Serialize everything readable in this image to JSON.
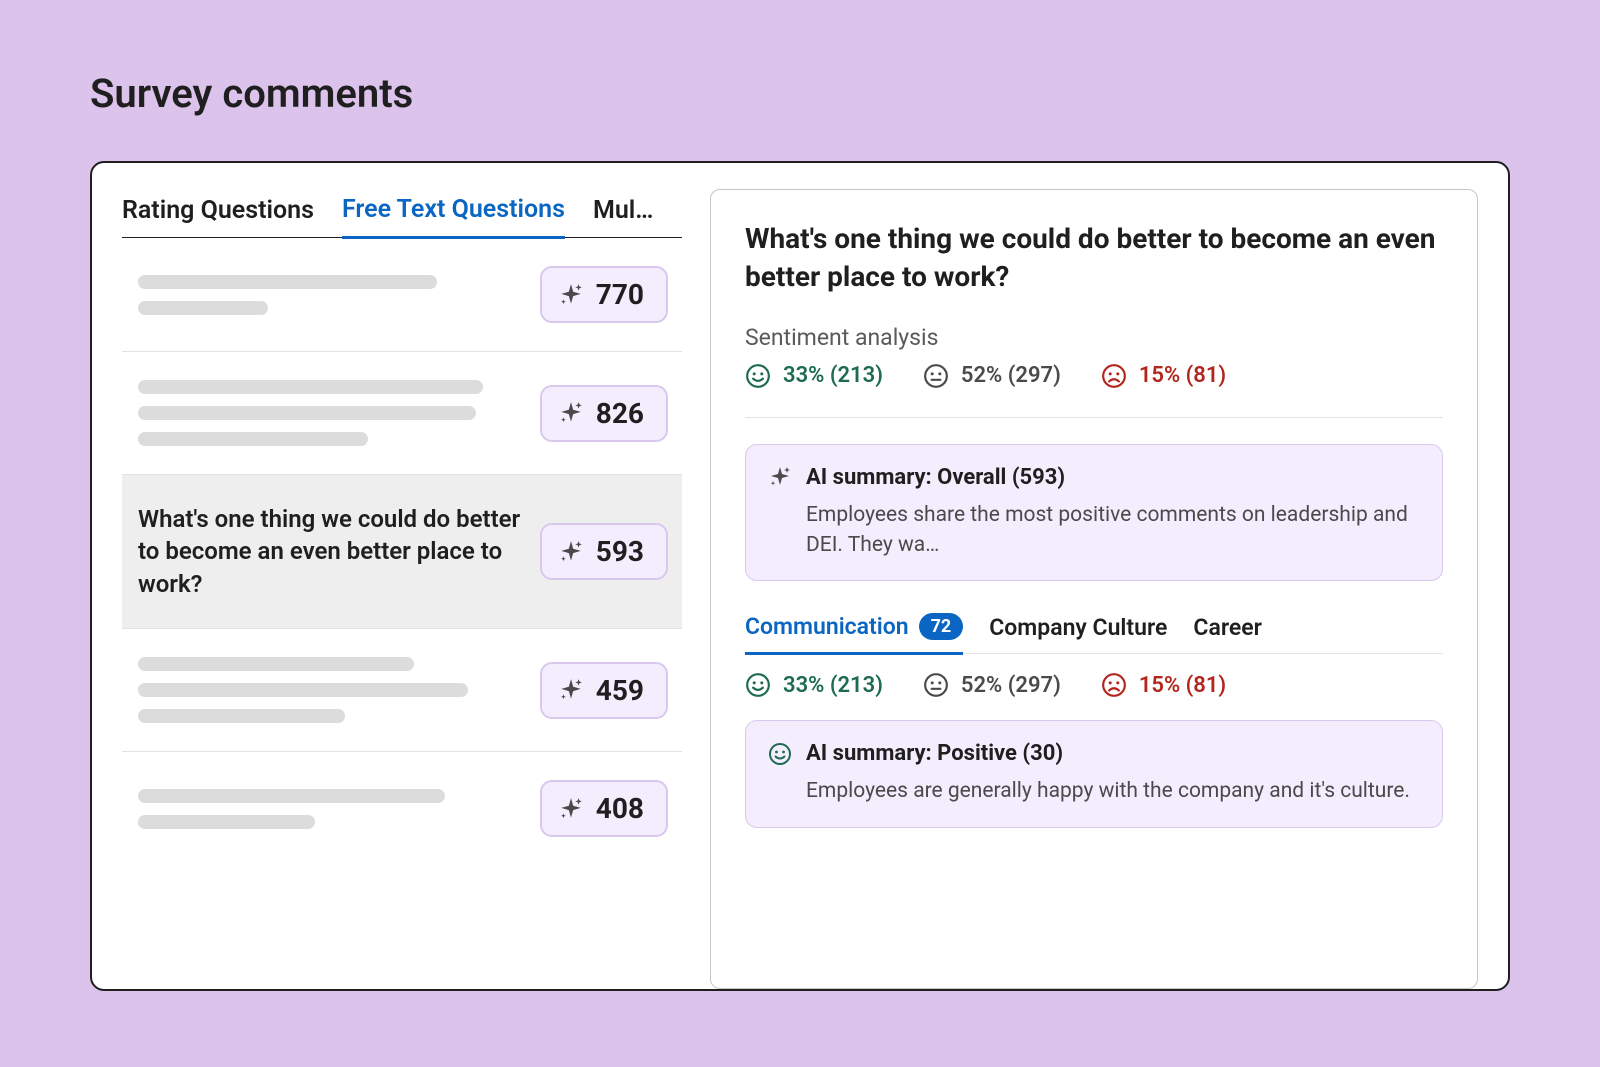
{
  "page": {
    "title": "Survey comments"
  },
  "tabs": {
    "rating": "Rating Questions",
    "freeText": "Free Text Questions",
    "multi": "Mult…"
  },
  "questions": [
    {
      "count": "770"
    },
    {
      "count": "826"
    },
    {
      "title": "What's one thing we could do better to become an even better place to work?",
      "count": "593",
      "selected": true
    },
    {
      "count": "459"
    },
    {
      "count": "408"
    }
  ],
  "detail": {
    "title": "What's one thing we could do better to become an even better place to work?",
    "sentimentLabel": "Sentiment analysis",
    "sentiment": {
      "positive": "33% (213)",
      "neutral": "52% (297)",
      "negative": "15% (81)"
    },
    "aiOverall": {
      "heading": "AI summary: Overall (593)",
      "body": "Employees share the most positive comments on leadership and DEI. They wa…"
    },
    "topics": {
      "communication": "Communication",
      "communicationBadge": "72",
      "culture": "Company Culture",
      "career": "Career"
    },
    "topicSentiment": {
      "positive": "33% (213)",
      "neutral": "52% (297)",
      "negative": "15% (81)"
    },
    "aiPositive": {
      "heading": "AI summary: Positive (30)",
      "body": "Employees are generally happy with the company and it's culture."
    }
  }
}
